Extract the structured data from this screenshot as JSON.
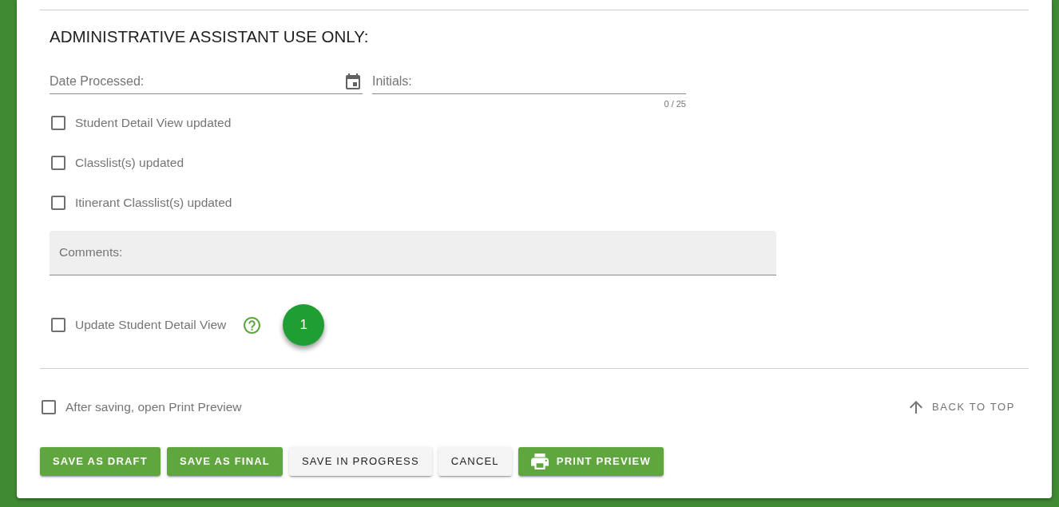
{
  "section": {
    "title": "ADMINISTRATIVE ASSISTANT USE ONLY:",
    "fields": [
      {
        "kind": "date",
        "placeholder": "Date Processed:"
      },
      {
        "kind": "text",
        "placeholder": "Initials:",
        "counter": "0 / 25"
      }
    ],
    "checklist": [
      {
        "label": "Student Detail View updated",
        "checked": false
      },
      {
        "label": "Classlist(s) updated",
        "checked": false
      },
      {
        "label": "Itinerant Classlist(s) updated",
        "checked": false
      }
    ],
    "comments": {
      "placeholder": "Comments:"
    },
    "update_option": {
      "label": "Update Student Detail View",
      "checked": false
    },
    "badge": "1"
  },
  "footer": {
    "print_option": {
      "label": "After saving, open Print Preview",
      "checked": false
    },
    "back_to_top": "BACK TO TOP",
    "buttons": [
      {
        "label": "SAVE AS DRAFT",
        "kind": "primary"
      },
      {
        "label": "SAVE AS FINAL",
        "kind": "primary"
      },
      {
        "label": "SAVE IN PROGRESS",
        "kind": "secondary"
      },
      {
        "label": "CANCEL",
        "kind": "secondary"
      },
      {
        "label": "PRINT PREVIEW",
        "kind": "print"
      }
    ]
  }
}
